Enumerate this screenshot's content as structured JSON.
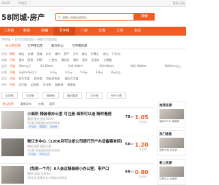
{
  "topbar": {
    "left": "58APP",
    "mid": "58首页",
    "right": "登录 注册"
  },
  "header": {
    "logo": "58同城·房产",
    "search_placeholder": "请输入关键词或地址",
    "search_button": "搜索"
  },
  "nav": {
    "items": [
      "二手房",
      "新房",
      "商铺",
      "写字楼",
      "厂房",
      "仓库",
      "土地",
      "车位"
    ],
    "active_index": 3
  },
  "breadcrumb": "58同城 > 北京写字楼出租 > 朝阳写字楼出租",
  "type_tabs": [
    "办公楼出租",
    "写字楼出售",
    "联合办公",
    "写字楼新盘"
  ],
  "filters": [
    {
      "label": "区域",
      "options": [
        "朝阳",
        "海淀",
        "东城",
        "西城",
        "丰台",
        "通州",
        "昌平",
        "大兴",
        "顺义",
        "石景山",
        "房山",
        "门头沟"
      ]
    },
    {
      "label": "商圈",
      "options": [
        "不限",
        "望京",
        "国贸",
        "CBD",
        "三里屯",
        "酒仙桥",
        "朝外",
        "双井",
        "亚运村",
        "大望路"
      ]
    },
    {
      "label": "面积",
      "options": [
        "不限",
        "50m²以下",
        "50-100m²",
        "100-200m²",
        "200-500m²",
        "500-1000m²",
        "1000m²以上"
      ]
    },
    {
      "label": "价格",
      "options": [
        "不限",
        "3元/m²/天以下",
        "3-4元",
        "4-5元",
        "5-6元",
        "6-8元",
        "8元以上"
      ]
    },
    {
      "label": "类型",
      "options": [
        "不限",
        "纯写字楼",
        "商住楼",
        "商业综合体",
        "酒店写字楼"
      ]
    },
    {
      "label": "特色",
      "options": [
        "不限",
        "可注册",
        "近地铁",
        "可分割",
        "精装修",
        "带家具"
      ]
    }
  ],
  "quick_tags": [
    "近地铁",
    "可注册",
    "精装修",
    "随时看房",
    "可分割",
    "免中介费"
  ],
  "sort": [
    "默认排序",
    "最新发布",
    "价格",
    "面积"
  ],
  "listings": [
    {
      "title": "小面积 精装修办公室 可注册 面积可以选 随时看房",
      "sub": "朝阳-望京 望京SOHO",
      "sub2": "5号线 距离望京站约500米",
      "tags": [
        "可注册",
        "精装修",
        "近地铁"
      ],
      "area": "70",
      "area_unit": "m²",
      "price": "1.05",
      "price_unit": "万元/月"
    },
    {
      "title": "物江市中心（1200月可注册公司银行开户办证备案单间）",
      "sub": "朝阳-国贸 国贸大厦",
      "sub2": "1号线 距离国贸站约300米",
      "tags": [
        "可注册",
        "拎包入住"
      ],
      "area": "50",
      "area_unit": "m²",
      "price": "1.20",
      "price_unit": "万元/月"
    },
    {
      "title": "（免税一个月）6人会议精装修小办公室，带户口",
      "sub": "朝阳-CBD 华贸中心",
      "sub2": "10号线 距离金台夕照站约400米",
      "tags": [
        "免税",
        "精装修"
      ],
      "area": "60",
      "area_unit": "m²",
      "price": "0.80",
      "price_unit": "万元/月"
    }
  ],
  "side_cards": [
    {
      "title": "推荐房源",
      "text": "望京SOHO 精装修",
      "price": "1.5万/月"
    },
    {
      "title": "热门楼盘",
      "text": "国贸大厦 可注册",
      "price": "2.0万/月"
    },
    {
      "title": "新上房源",
      "text": "华贸中心 近地铁",
      "price": "0.9万/月"
    }
  ],
  "colors": {
    "accent": "#f25c22",
    "nav_active": "#d94a12",
    "tag_text": "#5b8fd6"
  }
}
